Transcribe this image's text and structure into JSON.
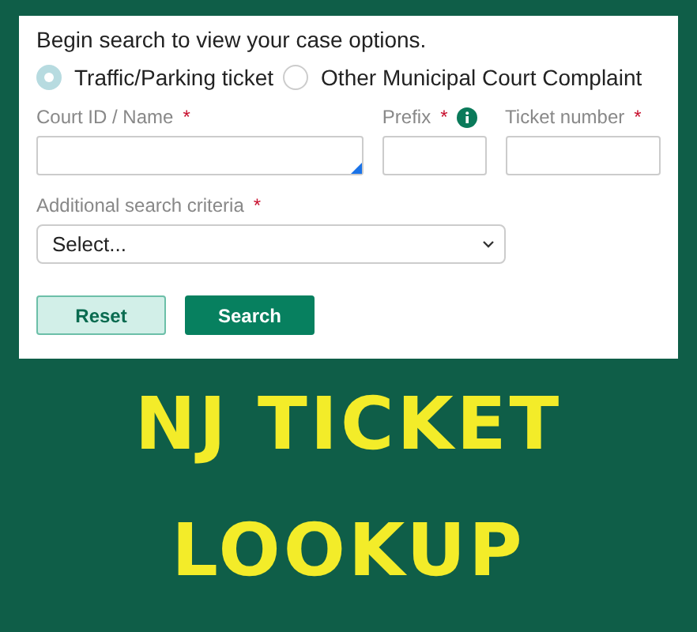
{
  "form": {
    "intro": "Begin search to view your case options.",
    "case_types": [
      {
        "label": "Traffic/Parking ticket",
        "selected": true
      },
      {
        "label": "Other Municipal Court Complaint",
        "selected": false
      }
    ],
    "fields": [
      {
        "label": "Court ID / Name",
        "required_mark": "*",
        "info": false,
        "kind": "autocomplete"
      },
      {
        "label": "Prefix",
        "required_mark": "*",
        "info": true,
        "kind": "text"
      },
      {
        "label": "Ticket number",
        "required_mark": "*",
        "info": false,
        "kind": "text"
      }
    ],
    "criteria": {
      "label": "Additional search criteria",
      "required_mark": "*",
      "value": "Select..."
    },
    "buttons": [
      {
        "label": "Reset",
        "kind": "secondary"
      },
      {
        "label": "Search",
        "kind": "primary"
      }
    ]
  },
  "banner": {
    "lines": [
      "NJ TICKET",
      "LOOKUP"
    ]
  }
}
